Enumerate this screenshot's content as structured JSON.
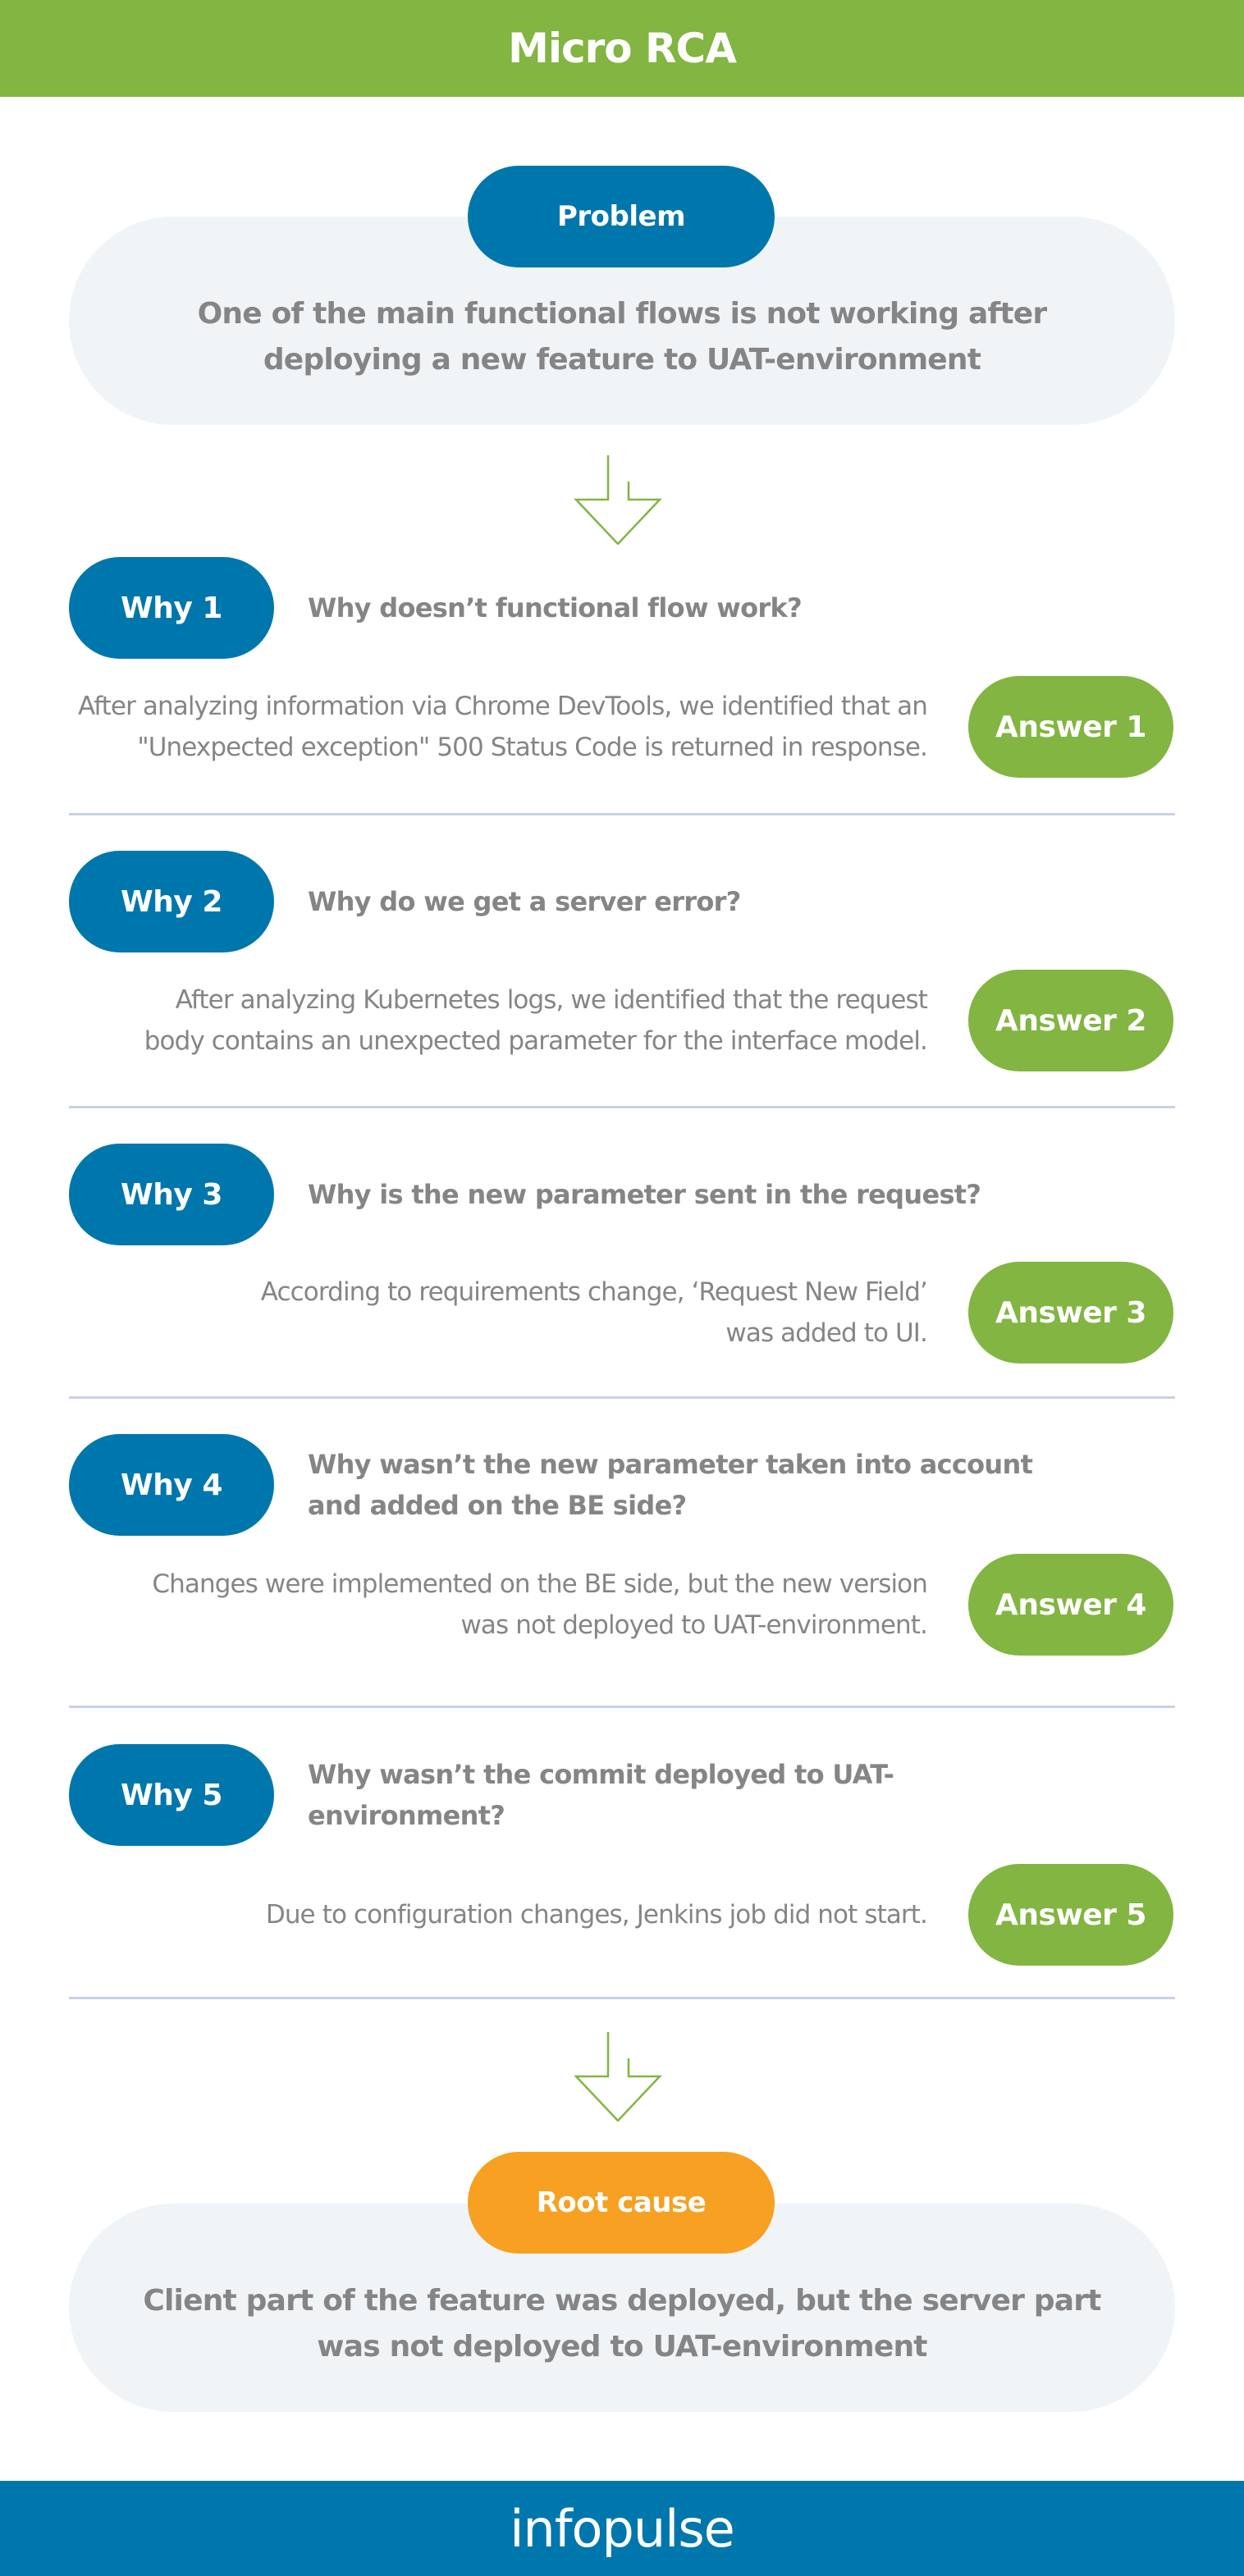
{
  "header": {
    "title": "Micro RCA"
  },
  "problem": {
    "label": "Problem",
    "text_line1": "One of the main functional flows is not working after",
    "text_line2": "deploying a new feature to UAT-environment"
  },
  "steps": [
    {
      "why_label": "Why 1",
      "question": [
        "Why doesn’t functional flow work?"
      ],
      "answer_label": "Answer 1",
      "answer": [
        "After analyzing information via Chrome DevTools, we identified that an",
        "\"Unexpected exception\" 500 Status Code is returned in response."
      ]
    },
    {
      "why_label": "Why 2",
      "question": [
        "Why do we get a server error?"
      ],
      "answer_label": "Answer 2",
      "answer": [
        "After analyzing Kubernetes logs, we identified that the request",
        "body contains an unexpected parameter for the interface model."
      ]
    },
    {
      "why_label": "Why 3",
      "question": [
        "Why is the new parameter sent in the request?"
      ],
      "answer_label": "Answer 3",
      "answer": [
        "According to requirements change, ‘Request New Field’",
        "was added to UI."
      ]
    },
    {
      "why_label": "Why 4",
      "question": [
        "Why wasn’t the new parameter taken into account",
        "and added on the BE side?"
      ],
      "answer_label": "Answer 4",
      "answer": [
        "Changes were implemented on the BE side, but the new version",
        "was not deployed to UAT-environment."
      ]
    },
    {
      "why_label": "Why 5",
      "question": [
        "Why wasn’t the commit deployed to UAT-environment?"
      ],
      "answer_label": "Answer 5",
      "answer": [
        "Due to configuration changes, Jenkins job did not start."
      ]
    }
  ],
  "root_cause": {
    "label": "Root cause",
    "text_line1": "Client part of the feature was deployed, but the server part",
    "text_line2": "was not deployed to UAT-environment"
  },
  "footer": {
    "brand": "infopulse"
  },
  "colors": {
    "header_green": "#82b541",
    "why_blue": "#0077ac",
    "answer_green": "#82b541",
    "root_orange": "#f7a021",
    "cloud_gray": "#f1f4f7",
    "text_gray": "#858585",
    "footer_blue": "#0077ac"
  },
  "icons": {
    "flow_arrow": "arrow-down-outline-icon"
  }
}
